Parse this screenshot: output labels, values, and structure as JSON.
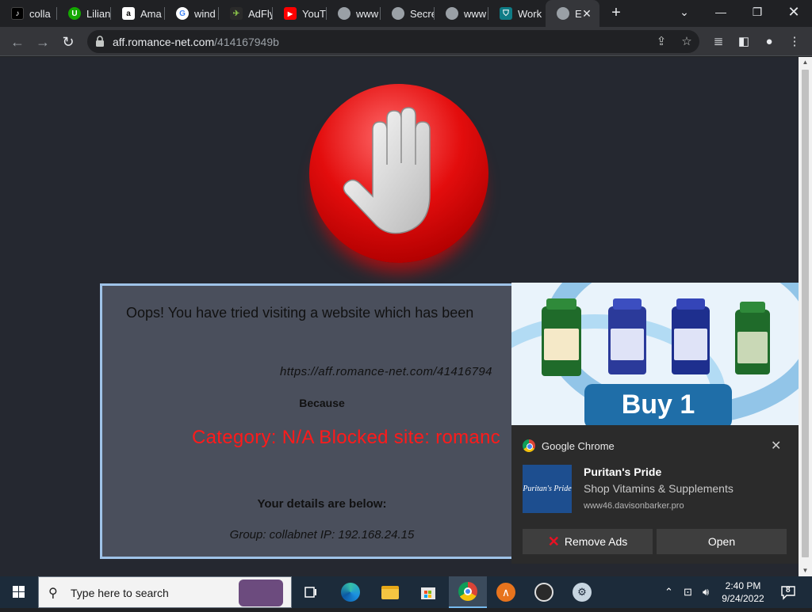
{
  "browser": {
    "tabs": [
      {
        "label": "colla",
        "icon": "tiktok-icon"
      },
      {
        "label": "Lilian",
        "icon": "upwork-icon"
      },
      {
        "label": "Ama",
        "icon": "amazon-icon"
      },
      {
        "label": "wind",
        "icon": "google-icon"
      },
      {
        "label": "AdFly",
        "icon": "adfly-icon"
      },
      {
        "label": "YouT",
        "icon": "youtube-icon"
      },
      {
        "label": "www",
        "icon": "globe-icon"
      },
      {
        "label": "Secre",
        "icon": "globe-icon"
      },
      {
        "label": "www",
        "icon": "globe-icon"
      },
      {
        "label": "Work",
        "icon": "shield-icon"
      },
      {
        "label": "E",
        "icon": "globe-icon"
      }
    ],
    "address": {
      "host": "aff.romance-net.com",
      "path": "/414167949b"
    }
  },
  "page": {
    "message": "Oops! You have tried visiting a website which has been",
    "blocked_url": "https://aff.romance-net.com/41416794",
    "because": "Because",
    "category": "Category: N/A  Blocked site: romanc",
    "details_heading": "Your details are below:",
    "group_ip": "Group: collabnet   IP: 192.168.24.15"
  },
  "notification": {
    "app": "Google Chrome",
    "ad_text": "Buy 1",
    "title": "Puritan's Pride",
    "subtitle": "Shop Vitamins & Supplements",
    "site": "www46.davisonbarker.pro",
    "logo_text": "Puritan's Pride",
    "buttons": {
      "remove_ads": "Remove Ads",
      "open": "Open"
    }
  },
  "taskbar": {
    "search_placeholder": "Type here to search",
    "time": "2:40 PM",
    "date": "9/24/2022",
    "notification_count": "8"
  }
}
